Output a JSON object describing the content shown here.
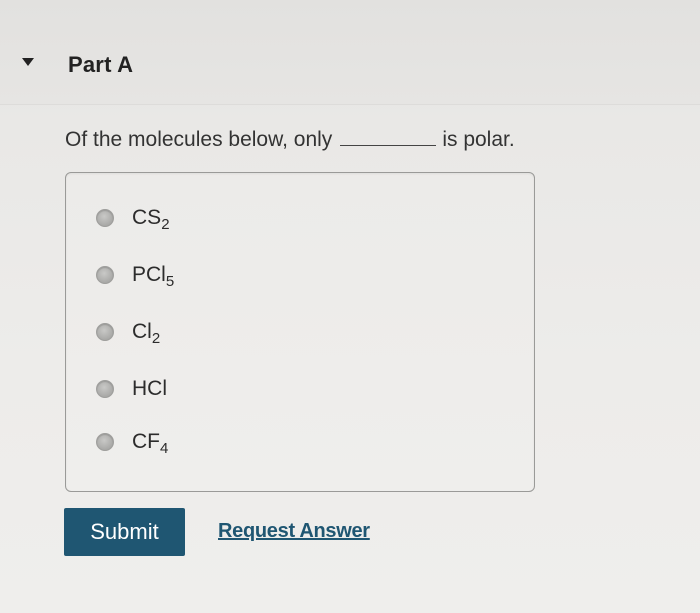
{
  "part": {
    "title": "Part A",
    "toggle_icon": "caret-down-icon"
  },
  "question": {
    "text_before": "Of the molecules below, only",
    "text_after": "is polar."
  },
  "choices": [
    {
      "base": "CS",
      "sub": "2"
    },
    {
      "base": "PCl",
      "sub": "5"
    },
    {
      "base": "Cl",
      "sub": "2"
    },
    {
      "base": "HCl",
      "sub": ""
    },
    {
      "base": "CF",
      "sub": "4"
    }
  ],
  "actions": {
    "submit_label": "Submit",
    "request_answer_label": "Request Answer"
  },
  "colors": {
    "primary": "#1f5672"
  }
}
